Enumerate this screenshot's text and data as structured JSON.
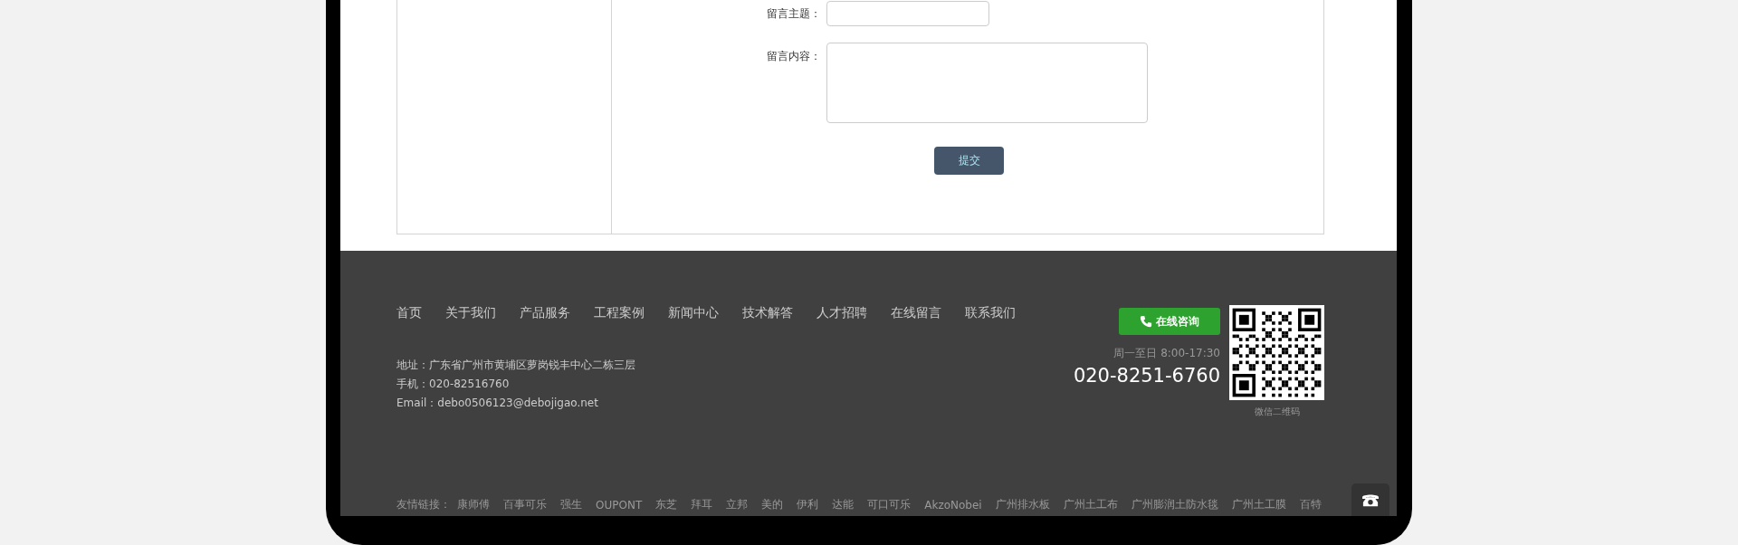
{
  "form": {
    "fields": [
      {
        "kind": "input",
        "label": "留言主题："
      },
      {
        "kind": "textarea",
        "label": "留言内容："
      }
    ],
    "submit": "提交"
  },
  "footer": {
    "nav": [
      "首页",
      "关于我们",
      "产品服务",
      "工程案例",
      "新闻中心",
      "技术解答",
      "人才招聘",
      "在线留言",
      "联系我们"
    ],
    "contact": [
      "地址：广东省广州市黄埔区萝岗锐丰中心二栋三层",
      "手机：020-82516760",
      "Email：debo0506123@debojigao.net"
    ],
    "consult_button": "在线咨询",
    "hours": "周一至日 8:00-17:30",
    "phone": "020-8251-6760",
    "qr_caption": "微信二维码",
    "links_label": "友情链接：",
    "links": [
      "康师傅",
      "百事可乐",
      "强生",
      "OUPONT",
      "东芝",
      "拜耳",
      "立邦",
      "美的",
      "伊利",
      "达能",
      "可口可乐",
      "AkzoNobei",
      "广州排水板",
      "广州土工布",
      "广州膨润土防水毯",
      "广州土工膜",
      "百特"
    ]
  }
}
